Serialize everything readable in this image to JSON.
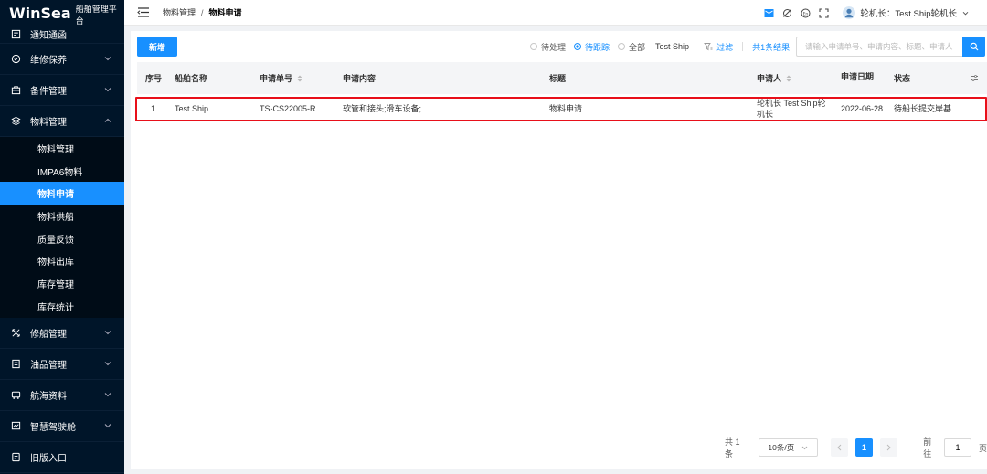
{
  "app": {
    "brand": "WinSea",
    "subtitle": "船舶管理平台"
  },
  "sidebar": {
    "items": [
      {
        "label": "通知通函",
        "icon": "notice-icon"
      },
      {
        "label": "维修保养",
        "icon": "maintenance-icon"
      },
      {
        "label": "备件管理",
        "icon": "spare-parts-icon"
      },
      {
        "label": "物料管理",
        "icon": "material-icon",
        "expanded": true
      },
      {
        "label": "修船管理",
        "icon": "ship-repair-icon"
      },
      {
        "label": "油品管理",
        "icon": "oil-icon"
      },
      {
        "label": "航海资料",
        "icon": "nautical-data-icon"
      },
      {
        "label": "智慧驾驶舱",
        "icon": "cockpit-icon"
      },
      {
        "label": "旧版入口",
        "icon": "old-entry-icon"
      }
    ],
    "submenu": [
      {
        "label": "物料管理"
      },
      {
        "label": "IMPA6物料"
      },
      {
        "label": "物料申请",
        "active": true
      },
      {
        "label": "物料供船"
      },
      {
        "label": "质量反馈"
      },
      {
        "label": "物料出库"
      },
      {
        "label": "库存管理"
      },
      {
        "label": "库存统计"
      }
    ]
  },
  "header": {
    "breadcrumb": [
      "物料管理",
      "/",
      "物料申请"
    ],
    "user": "轮机长：Test Ship轮机长"
  },
  "toolbar": {
    "new_label": "新增",
    "radios": [
      {
        "label": "待处理",
        "checked": false
      },
      {
        "label": "待跟踪",
        "checked": true
      },
      {
        "label": "全部",
        "checked": false
      }
    ],
    "ship": "Test Ship",
    "filter_label": "过滤",
    "result_count": "共1条结果",
    "search_placeholder": "请输入申请单号、申请内容、标题、申请人"
  },
  "table": {
    "columns": [
      "序号",
      "船舶名称",
      "申请单号",
      "申请内容",
      "标题",
      "申请人",
      "申请日期",
      "状态"
    ],
    "rows": [
      {
        "index": "1",
        "ship": "Test Ship",
        "number": "TS-CS22005-R",
        "content": "软管和接头;滑车设备;",
        "title": "物料申请",
        "applicant": "轮机长 Test Ship轮机长",
        "date": "2022-06-28",
        "status": "待船长提交岸基"
      }
    ]
  },
  "pagination": {
    "total": "共 1 条",
    "page_size": "10条/页",
    "current": "1",
    "goto_prefix": "前往",
    "goto_value": "1",
    "goto_suffix": "页"
  },
  "colors": {
    "sidebar_bg": "#001529",
    "accent": "#1890ff",
    "highlight": "#e8101a"
  }
}
